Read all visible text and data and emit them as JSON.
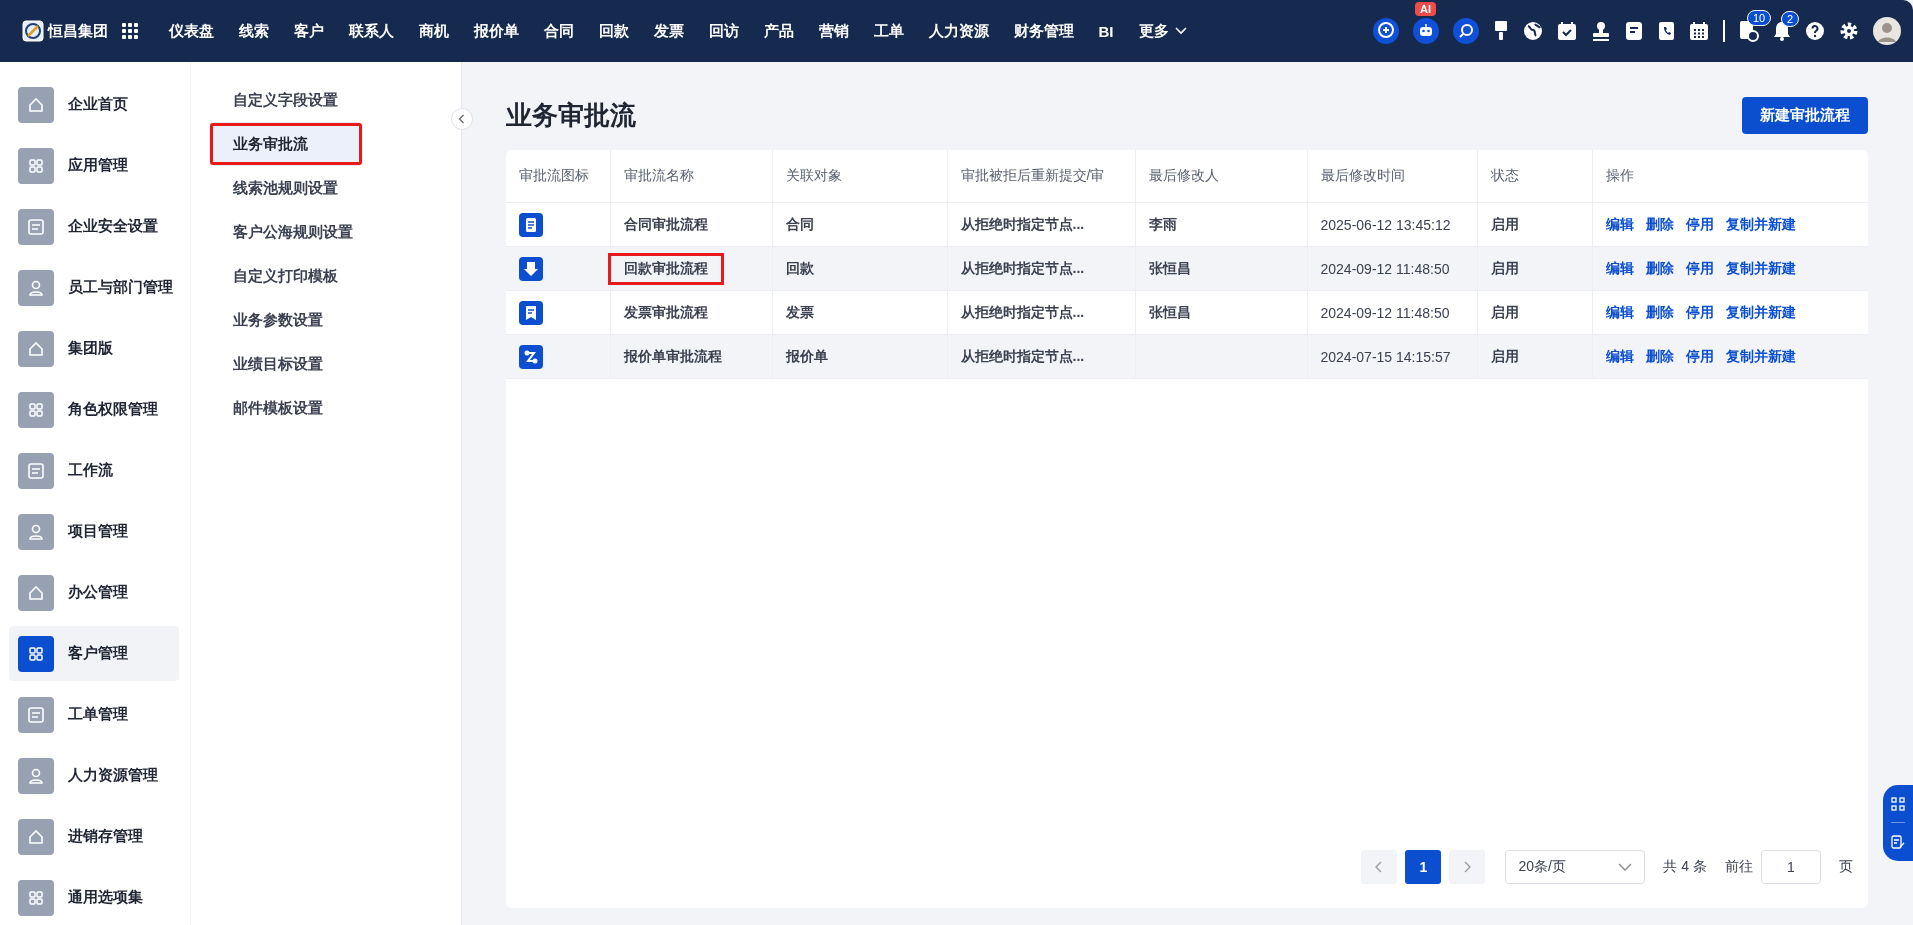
{
  "topbar": {
    "brand": "恒昌集团",
    "nav": [
      "仪表盘",
      "线索",
      "客户",
      "联系人",
      "商机",
      "报价单",
      "合同",
      "回款",
      "发票",
      "回访",
      "产品",
      "营销",
      "工单",
      "人力资源",
      "财务管理",
      "BI"
    ],
    "more": "更多",
    "ai_badge": "AI",
    "todo_badge": "10",
    "bell_badge": "2"
  },
  "sidebar": {
    "items": [
      {
        "label": "企业首页",
        "selected": false
      },
      {
        "label": "应用管理",
        "selected": false
      },
      {
        "label": "企业安全设置",
        "selected": false
      },
      {
        "label": "员工与部门管理",
        "selected": false
      },
      {
        "label": "集团版",
        "selected": false
      },
      {
        "label": "角色权限管理",
        "selected": false
      },
      {
        "label": "工作流",
        "selected": false
      },
      {
        "label": "项目管理",
        "selected": false
      },
      {
        "label": "办公管理",
        "selected": false
      },
      {
        "label": "客户管理",
        "selected": true
      },
      {
        "label": "工单管理",
        "selected": false
      },
      {
        "label": "人力资源管理",
        "selected": false
      },
      {
        "label": "进销存管理",
        "selected": false
      },
      {
        "label": "通用选项集",
        "selected": false
      }
    ]
  },
  "submenu": {
    "items": [
      {
        "label": "自定义字段设置",
        "selected": false,
        "highlighted": false
      },
      {
        "label": "业务审批流",
        "selected": true,
        "highlighted": true
      },
      {
        "label": "线索池规则设置",
        "selected": false,
        "highlighted": false
      },
      {
        "label": "客户公海规则设置",
        "selected": false,
        "highlighted": false
      },
      {
        "label": "自定义打印模板",
        "selected": false,
        "highlighted": false
      },
      {
        "label": "业务参数设置",
        "selected": false,
        "highlighted": false
      },
      {
        "label": "业绩目标设置",
        "selected": false,
        "highlighted": false
      },
      {
        "label": "邮件模板设置",
        "selected": false,
        "highlighted": false
      }
    ]
  },
  "page": {
    "title": "业务审批流",
    "new_button": "新建审批流程"
  },
  "table": {
    "columns": [
      "审批流图标",
      "审批流名称",
      "关联对象",
      "审批被拒后重新提交/审",
      "最后修改人",
      "最后修改时间",
      "状态",
      "操作"
    ],
    "rows": [
      {
        "name": "合同审批流程",
        "highlighted": false,
        "object": "合同",
        "resubmit": "从拒绝时指定节点...",
        "modifier": "李雨",
        "modified_at": "2025-06-12 13:45:12",
        "status": "启用",
        "actions": [
          "编辑",
          "删除",
          "停用",
          "复制并新建"
        ]
      },
      {
        "name": "回款审批流程",
        "highlighted": true,
        "object": "回款",
        "resubmit": "从拒绝时指定节点...",
        "modifier": "张恒昌",
        "modified_at": "2024-09-12 11:48:50",
        "status": "启用",
        "actions": [
          "编辑",
          "删除",
          "停用",
          "复制并新建"
        ]
      },
      {
        "name": "发票审批流程",
        "highlighted": false,
        "object": "发票",
        "resubmit": "从拒绝时指定节点...",
        "modifier": "张恒昌",
        "modified_at": "2024-09-12 11:48:50",
        "status": "启用",
        "actions": [
          "编辑",
          "删除",
          "停用",
          "复制并新建"
        ]
      },
      {
        "name": "报价单审批流程",
        "highlighted": false,
        "object": "报价单",
        "resubmit": "从拒绝时指定节点...",
        "modified_at": "2024-07-15 14:15:57",
        "status": "启用",
        "actions": [
          "编辑",
          "删除",
          "停用",
          "复制并新建"
        ]
      }
    ]
  },
  "pagination": {
    "pages": [
      {
        "label": "1",
        "selected": true
      }
    ],
    "page_size": "20条/页",
    "total": "共 4 条",
    "goto_label": "前往",
    "goto_value": "1",
    "page_suffix": "页"
  }
}
